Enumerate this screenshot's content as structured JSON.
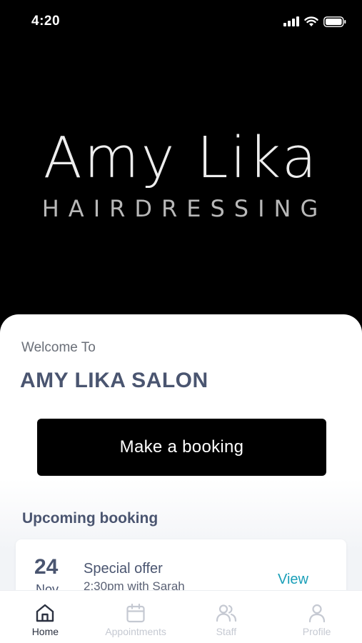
{
  "status_bar": {
    "time": "4:20"
  },
  "hero": {
    "logo_name": "Amy Lika",
    "logo_sub": "HAIRDRESSING"
  },
  "main": {
    "welcome": "Welcome To",
    "salon_name": "AMY LIKA SALON",
    "book_button": "Make a booking",
    "upcoming_title": "Upcoming booking",
    "booking": {
      "day": "24",
      "month": "Nov",
      "title": "Special offer",
      "time": "2:30pm with Sarah",
      "view_label": "View"
    }
  },
  "tabs": [
    {
      "label": "Home",
      "icon": "home-icon",
      "active": true
    },
    {
      "label": "Appointments",
      "icon": "calendar-icon",
      "active": false
    },
    {
      "label": "Staff",
      "icon": "users-icon",
      "active": false
    },
    {
      "label": "Profile",
      "icon": "user-icon",
      "active": false
    }
  ],
  "colors": {
    "accent": "#1a9fb8",
    "heading": "#4a5570",
    "button": "#000000"
  }
}
